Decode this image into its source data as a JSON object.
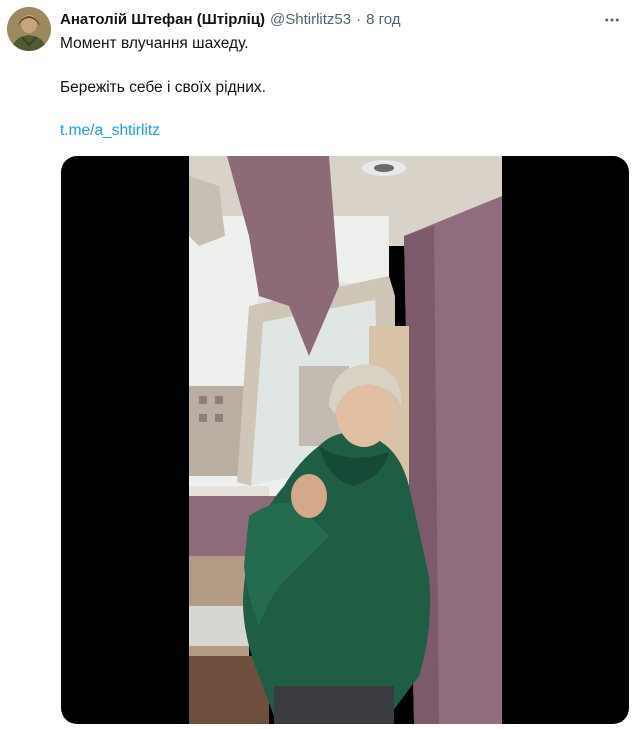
{
  "author": {
    "display_name": "Анатолій Штефан (Штірліц)",
    "handle": "@Shtirlitz53",
    "separator": "·",
    "time": "8 год",
    "avatar_icon": "avatar-icon"
  },
  "tweet": {
    "line1": "Момент влучання шахеду.",
    "line2": "Бережіть себе і своїх рідних.",
    "link": "t.me/a_shtirlitz"
  },
  "media": {
    "type": "video",
    "icon": "video-thumbnail"
  },
  "colors": {
    "link": "#1d9bf0",
    "secondary_text": "#536471",
    "primary_text": "#0f1419"
  }
}
